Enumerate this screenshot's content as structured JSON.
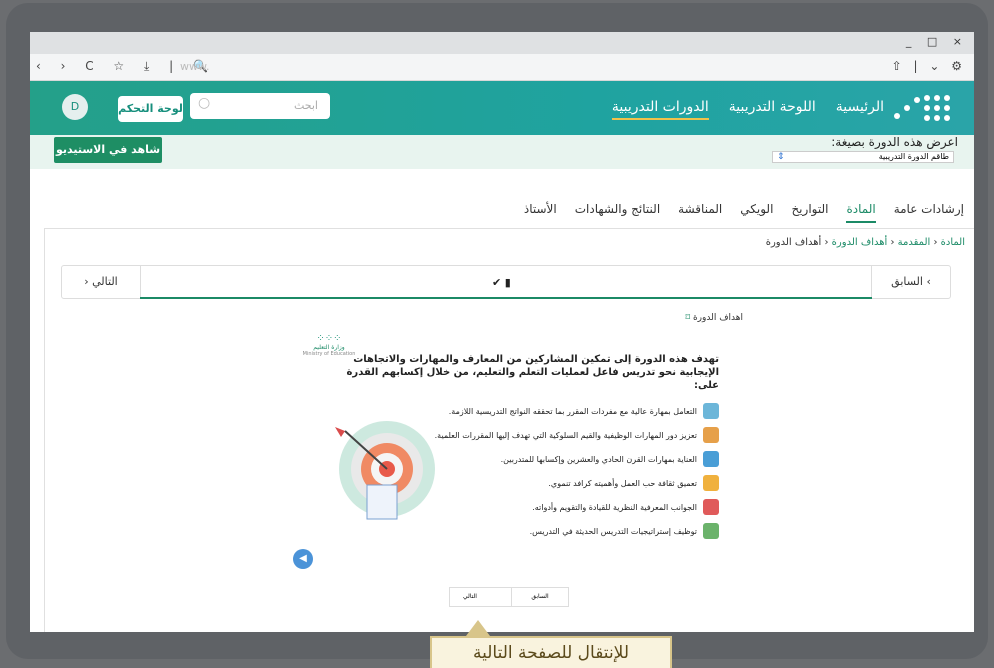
{
  "browser": {
    "url": "www.",
    "window_controls": "_ □ ×"
  },
  "header": {
    "menu": [
      "الرئيسية",
      "اللوحة التدريبية",
      "الدورات التدريبية"
    ],
    "search_placeholder": "ابحث",
    "dashboard_button": "لوحة التحكم",
    "avatar_letter": "D"
  },
  "subbar": {
    "view_as_label": "اعرض هذه الدورة بصيغة:",
    "view_as_value": "طاقم الدورة التدريبية",
    "studio_button": "شاهد في الاستيديو"
  },
  "tabs": [
    "إرشادات عامة",
    "المادة",
    "التواريخ",
    "الويكي",
    "المناقشة",
    "النتائج والشهادات",
    "الأستاذ"
  ],
  "breadcrumb": {
    "root": "المادة",
    "level1": "المقدمة",
    "level2": "أهداف الدورة",
    "current": "أهداف الدورة"
  },
  "pager": {
    "prev": "السابق",
    "next": "التالي"
  },
  "slide": {
    "title": "اهداف الدورة",
    "lead": "تهدف هذه الدورة إلى تمكين المشاركين من المعارف والمهارات والاتجاهات الإيجابية نحو تدريس فاعل لعمليات التعلم والتعليم، من خلال إكسابهم القدرة على:",
    "ministry": "وزارة التعليم",
    "ministry_en": "Ministry of Education",
    "items": [
      "التعامل بمهارة عالية مع مفردات المقرر بما تحققه النواتج التدريسية اللازمة.",
      "تعزيز دور المهارات الوظيفية والقيم السلوكية التي تهدف إليها المقررات العلمية.",
      "العناية بمهارات القرن الحادي والعشرين وإكسابها للمتدربين.",
      "تعميق ثقافة حب العمل وأهميته كرافد تنموي.",
      "الجوانب المعرفية النظرية للقيادة والتقويم وأدواته.",
      "توظيف إستراتيجيات التدريس الحديثة في التدريس."
    ],
    "item_colors": [
      "#6cb6d9",
      "#e6a04a",
      "#4a9ed6",
      "#f0b13e",
      "#e05a5a",
      "#6bb36b"
    ]
  },
  "mini_pager": {
    "prev": "السابق",
    "next": "التالي"
  },
  "callout": "للإنتقال للصفحة التالية"
}
